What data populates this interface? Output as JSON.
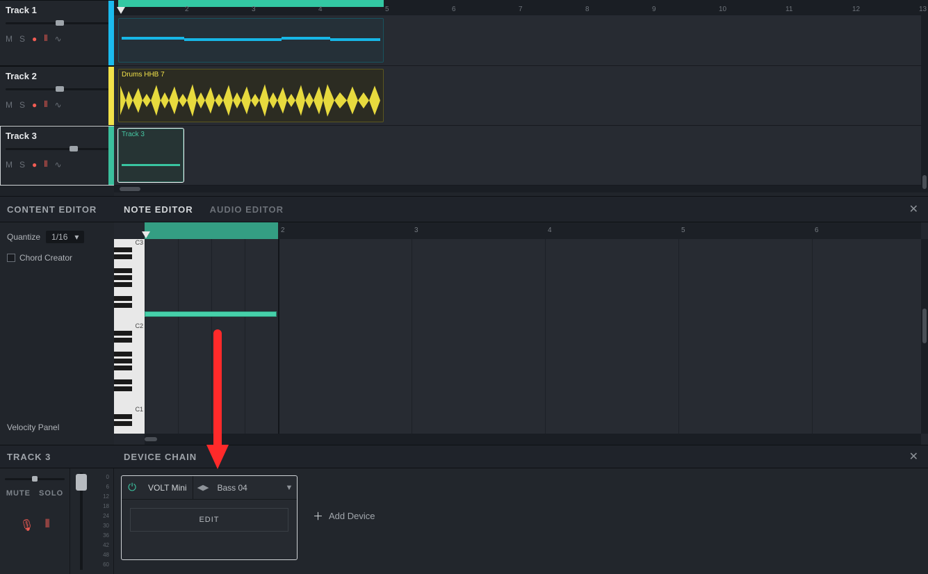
{
  "ruler_top": {
    "marks": [
      "2",
      "3",
      "4",
      "5",
      "6",
      "7",
      "8",
      "9",
      "10",
      "11",
      "12",
      "13"
    ]
  },
  "tracks": [
    {
      "name": "Track 1",
      "btn_m": "M",
      "btn_s": "S"
    },
    {
      "name": "Track 2",
      "btn_m": "M",
      "btn_s": "S"
    },
    {
      "name": "Track 3",
      "btn_m": "M",
      "btn_s": "S"
    }
  ],
  "clips": {
    "drums_label": "Drums HHB 7",
    "track3_label": "Track 3"
  },
  "content_editor": {
    "title": "CONTENT EDITOR",
    "quantize_label": "Quantize",
    "quantize_value": "1/16",
    "chord_creator": "Chord Creator",
    "velocity_panel": "Velocity Panel"
  },
  "editor_tabs": {
    "note": "NOTE EDITOR",
    "audio": "AUDIO EDITOR"
  },
  "piano": {
    "labels": [
      "C3",
      "C2",
      "C1"
    ],
    "ruler_marks": [
      "2",
      "3",
      "4",
      "5",
      "6"
    ]
  },
  "track_section": {
    "title": "TRACK 3",
    "mute": "MUTE",
    "solo": "SOLO"
  },
  "device_chain": {
    "title": "DEVICE CHAIN",
    "device_name": "VOLT Mini",
    "preset": "Bass 04",
    "edit": "EDIT",
    "add": "Add Device"
  },
  "fader_scale": [
    "0",
    "6",
    "12",
    "18",
    "24",
    "30",
    "36",
    "42",
    "48",
    "60"
  ]
}
